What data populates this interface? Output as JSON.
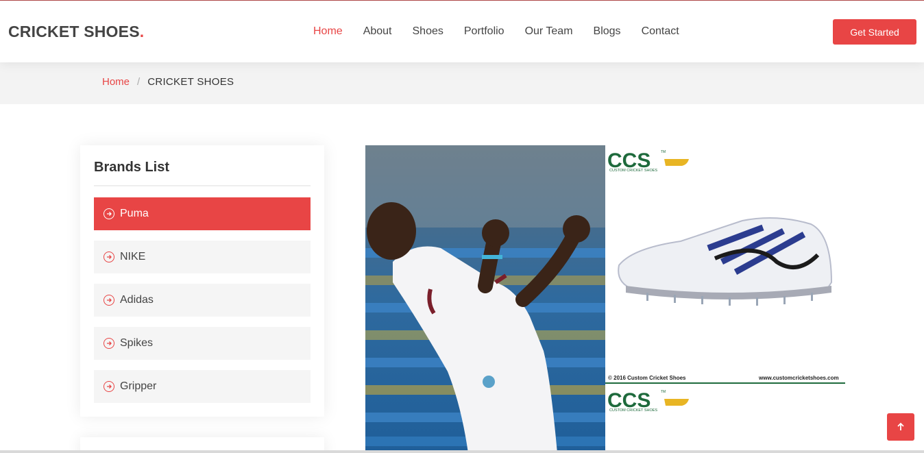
{
  "header": {
    "logo_text": "CRICKET SHOES",
    "logo_dot": ".",
    "nav": [
      {
        "label": "Home",
        "active": true
      },
      {
        "label": "About",
        "active": false
      },
      {
        "label": "Shoes",
        "active": false
      },
      {
        "label": "Portfolio",
        "active": false
      },
      {
        "label": "Our Team",
        "active": false
      },
      {
        "label": "Blogs",
        "active": false
      },
      {
        "label": "Contact",
        "active": false
      }
    ],
    "cta_label": "Get Started"
  },
  "breadcrumb": {
    "home": "Home",
    "separator": "/",
    "current": "CRICKET SHOES"
  },
  "sidebar": {
    "title": "Brands List",
    "items": [
      {
        "label": "Puma",
        "active": true
      },
      {
        "label": "NIKE",
        "active": false
      },
      {
        "label": "Adidas",
        "active": false
      },
      {
        "label": "Spikes",
        "active": false
      },
      {
        "label": "Gripper",
        "active": false
      }
    ]
  },
  "gallery": {
    "shoe_logo": "CCS",
    "shoe_logo_tm": "TM",
    "shoe_logo_sub": "CUSTOM CRICKET SHOES",
    "shoe_footer_left": "© 2016 Custom Cricket Shoes",
    "shoe_footer_right": "www.customcricketshoes.com"
  },
  "colors": {
    "accent": "#e84545",
    "breadcrumb_bg": "#f3f3f3",
    "item_bg": "#f5f5f5"
  },
  "icons": {
    "brand_item": "arrow-right-circle-icon",
    "back_to_top": "arrow-up-icon"
  }
}
